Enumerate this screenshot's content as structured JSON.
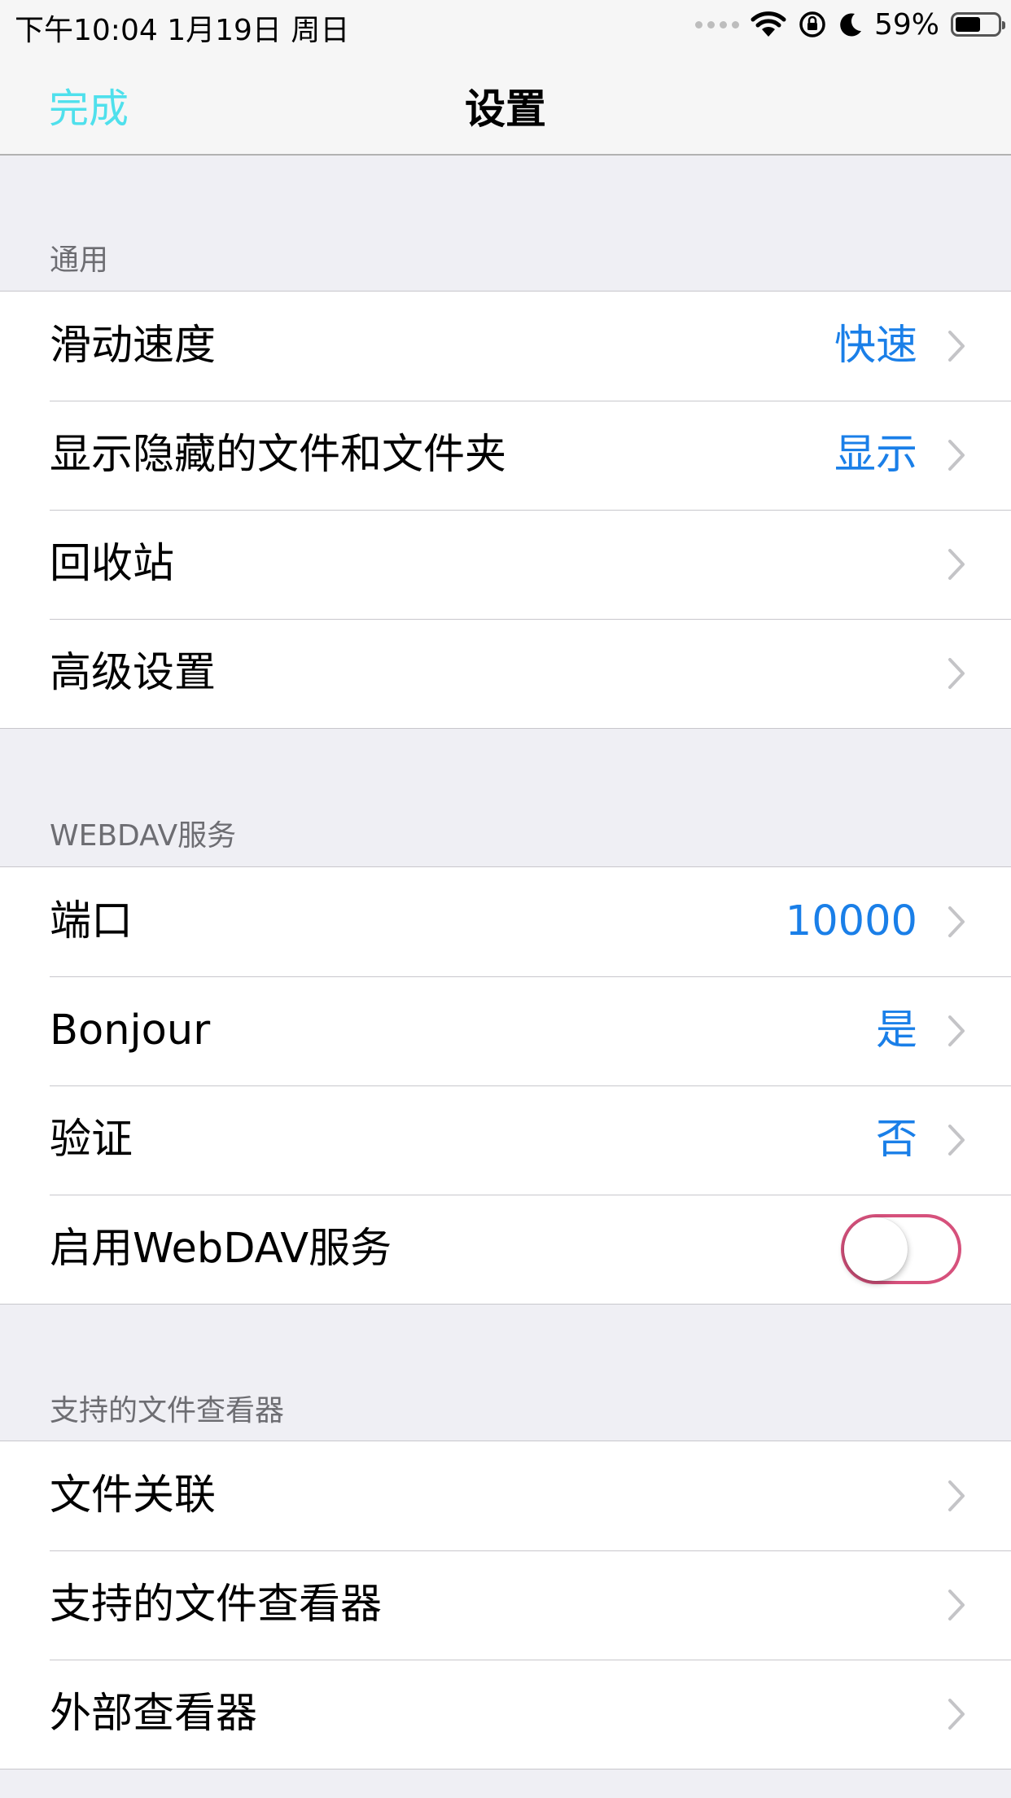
{
  "status_bar": {
    "time": "下午10:04   1月19日 周日",
    "battery_percent": "59%",
    "battery_level": 0.59,
    "icons": [
      "signal-dots-icon",
      "wifi-icon",
      "orientation-lock-icon",
      "moon-icon",
      "battery-icon"
    ]
  },
  "nav": {
    "done_label": "完成",
    "title": "设置"
  },
  "sections": {
    "general": {
      "header": "通用",
      "rows": [
        {
          "label": "滑动速度",
          "value": "快速"
        },
        {
          "label": "显示隐藏的文件和文件夹",
          "value": "显示"
        },
        {
          "label": "回收站",
          "value": ""
        },
        {
          "label": "高级设置",
          "value": ""
        }
      ]
    },
    "webdav": {
      "header": "WEBDAV服务",
      "rows": [
        {
          "label": "端口",
          "value": "10000"
        },
        {
          "label": "Bonjour",
          "value": "是"
        },
        {
          "label": "验证",
          "value": "否"
        },
        {
          "label": "启用WebDAV服务",
          "toggle_on": false
        }
      ]
    },
    "viewers": {
      "header": "支持的文件查看器",
      "rows": [
        {
          "label": "文件关联",
          "value": ""
        },
        {
          "label": "支持的文件查看器",
          "value": ""
        },
        {
          "label": "外部查看器",
          "value": ""
        }
      ]
    }
  },
  "colors": {
    "accent_done": "#4fe0ec",
    "value_blue": "#1a7fe8",
    "toggle_border": "#d6517c",
    "background": "#efeff4"
  }
}
